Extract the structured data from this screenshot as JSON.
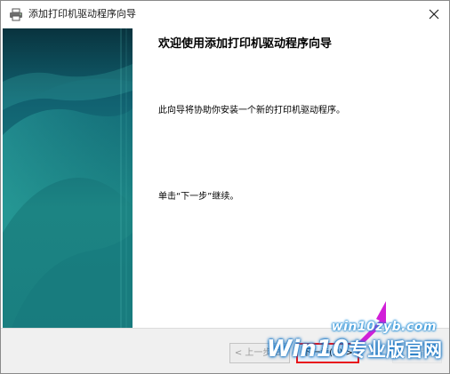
{
  "window": {
    "title": "添加打印机驱动程序向导",
    "close_label": "×"
  },
  "main": {
    "heading": "欢迎使用添加打印机驱动程序向导",
    "description": "此向导将协助你安装一个新的打印机驱动程序。",
    "hint": "单击“下一步”继续。"
  },
  "buttons": {
    "back_label": "< 上一步(B)",
    "next_label": "下一步(N) >",
    "cancel_label": "取消"
  },
  "watermark": {
    "site": "win10zyb.com",
    "brand": "Win10",
    "brand_cn": "专业版官网"
  },
  "colors": {
    "highlight": "#e8141a",
    "arrow": "#d11fd8",
    "panel_dark": "#0a4a55",
    "panel_light": "#2a9b9a"
  }
}
